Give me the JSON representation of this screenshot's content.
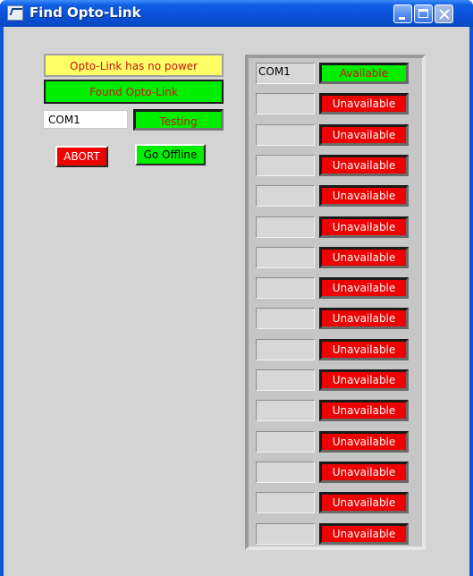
{
  "window": {
    "title": "Find Opto-Link"
  },
  "status": {
    "power_message": "Opto-Link has no power",
    "found_message": "Found Opto-Link",
    "current_port": "COM1",
    "test_state": "Testing"
  },
  "buttons": {
    "abort_label": "ABORT",
    "offline_label": "Go Offline"
  },
  "ports": [
    {
      "name": "COM1",
      "status": "Available"
    },
    {
      "name": "",
      "status": "Unavailable"
    },
    {
      "name": "",
      "status": "Unavailable"
    },
    {
      "name": "",
      "status": "Unavailable"
    },
    {
      "name": "",
      "status": "Unavailable"
    },
    {
      "name": "",
      "status": "Unavailable"
    },
    {
      "name": "",
      "status": "Unavailable"
    },
    {
      "name": "",
      "status": "Unavailable"
    },
    {
      "name": "",
      "status": "Unavailable"
    },
    {
      "name": "",
      "status": "Unavailable"
    },
    {
      "name": "",
      "status": "Unavailable"
    },
    {
      "name": "",
      "status": "Unavailable"
    },
    {
      "name": "",
      "status": "Unavailable"
    },
    {
      "name": "",
      "status": "Unavailable"
    },
    {
      "name": "",
      "status": "Unavailable"
    },
    {
      "name": "",
      "status": "Unavailable"
    }
  ],
  "colors": {
    "available": "#00ee00",
    "unavailable": "#ee0000",
    "power_warning": "#ffff66",
    "titlebar": "#0a50d6"
  }
}
